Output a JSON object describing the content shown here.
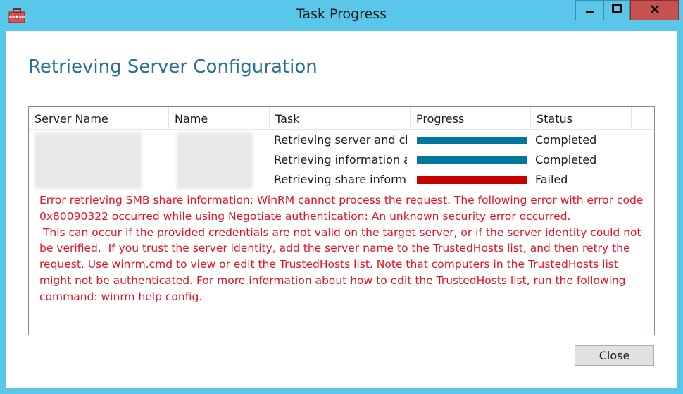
{
  "window": {
    "title": "Task Progress"
  },
  "page": {
    "heading": "Retrieving Server Configuration"
  },
  "grid": {
    "columns": [
      "Server Name",
      "Name",
      "Task",
      "Progress",
      "Status"
    ],
    "rows": [
      {
        "task": "Retrieving server and clus",
        "progress": 100,
        "status": "Completed",
        "bar_color": "#00759e"
      },
      {
        "task": "Retrieving information ab",
        "progress": 100,
        "status": "Completed",
        "bar_color": "#00759e"
      },
      {
        "task": "Retrieving share informat",
        "progress": 100,
        "status": "Failed",
        "bar_color": "#c80000"
      }
    ],
    "error_message": "Error retrieving SMB share information: WinRM cannot process the request. The following error with error code 0x80090322 occurred while using Negotiate authentication: An unknown security error occurred.\n This can occur if the provided credentials are not valid on the target server, or if the server identity could not be verified.  If you trust the server identity, add the server name to the TrustedHosts list, and then retry the request. Use winrm.cmd to view or edit the TrustedHosts list. Note that computers in the TrustedHosts list might not be authenticated. For more information about how to edit the TrustedHosts list, run the following command: winrm help config."
  },
  "footer": {
    "close_label": "Close"
  },
  "icons": {
    "app": "toolbox-icon",
    "minimize": "minimize-icon",
    "maximize": "maximize-icon",
    "close": "close-icon"
  },
  "colors": {
    "titlebar": "#5ac7ea",
    "heading": "#2a6f97",
    "error": "#e81123",
    "close_button": "#c75050"
  }
}
